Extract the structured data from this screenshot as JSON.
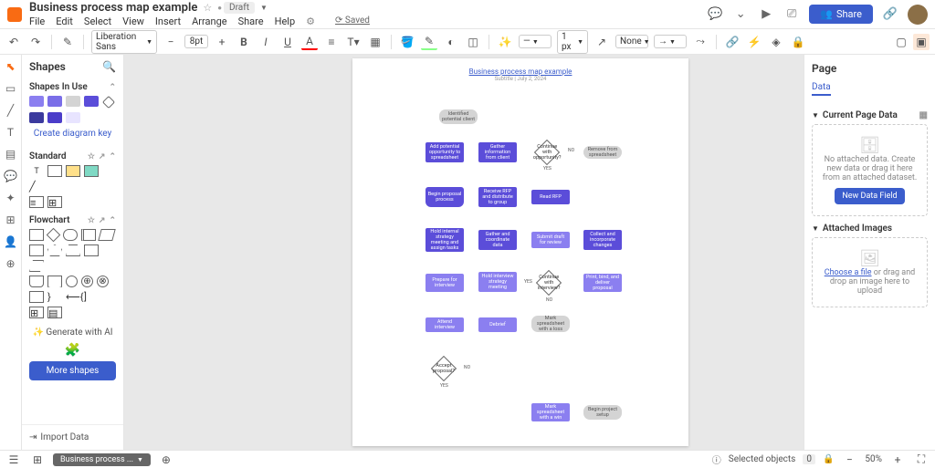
{
  "header": {
    "title": "Business process map example",
    "status": "Draft",
    "saved": "Saved",
    "menu": [
      "File",
      "Edit",
      "Select",
      "View",
      "Insert",
      "Arrange",
      "Share",
      "Help"
    ],
    "share_label": "Share"
  },
  "toolbar": {
    "font": "Liberation Sans",
    "font_size": "8pt",
    "line_width": "1 px",
    "line_end": "None"
  },
  "shapes_panel": {
    "title": "Shapes",
    "in_use": "Shapes In Use",
    "diagram_key": "Create diagram key",
    "standard": "Standard",
    "flowchart": "Flowchart",
    "generate_ai": "Generate with AI",
    "more_shapes": "More shapes",
    "import_data": "Import Data"
  },
  "canvas": {
    "doc_title": "Business process map example",
    "doc_sub": "Subtitle | July 2, 2024",
    "nodes": {
      "n1": "Identified potential client",
      "n2": "Add potential opportunity to spreadsheet",
      "n3": "Gather information from client",
      "n4": "Continue with opportunity?",
      "n5": "Remove from spreadsheet",
      "n6": "Begin proposal process",
      "n7": "Receive RFP and distribute to group",
      "n8": "Read RFP",
      "n9": "Hold internal strategy meeting and assign tasks",
      "n10": "Gather and coordinate data",
      "n11": "Submit draft for review",
      "n12": "Collect and incorporate changes",
      "n13": "Prepare for interview",
      "n14": "Hold interview strategy meeting",
      "n15": "Continue with interview?",
      "n16": "Print, bind, and deliver proposal",
      "n17": "Attend interview",
      "n18": "Debrief",
      "n19": "Mark spreadsheet with a loss",
      "n20": "Accept proposal?",
      "n21": "Mark spreadsheet with a win",
      "n22": "Begin project setup"
    },
    "labels": {
      "yes": "YES",
      "no": "NO"
    }
  },
  "right_panel": {
    "title": "Page",
    "tab": "Data",
    "current_page": "Current Page Data",
    "no_data": "No attached data. Create new data or drag it here from an attached dataset.",
    "new_field": "New Data Field",
    "attached_images": "Attached Images",
    "choose_file": "Choose a file",
    "or_drag": " or drag and drop an image here to upload"
  },
  "statusbar": {
    "tab_name": "Business process ...",
    "selected": "Selected objects",
    "selected_count": "0",
    "zoom": "50%"
  }
}
